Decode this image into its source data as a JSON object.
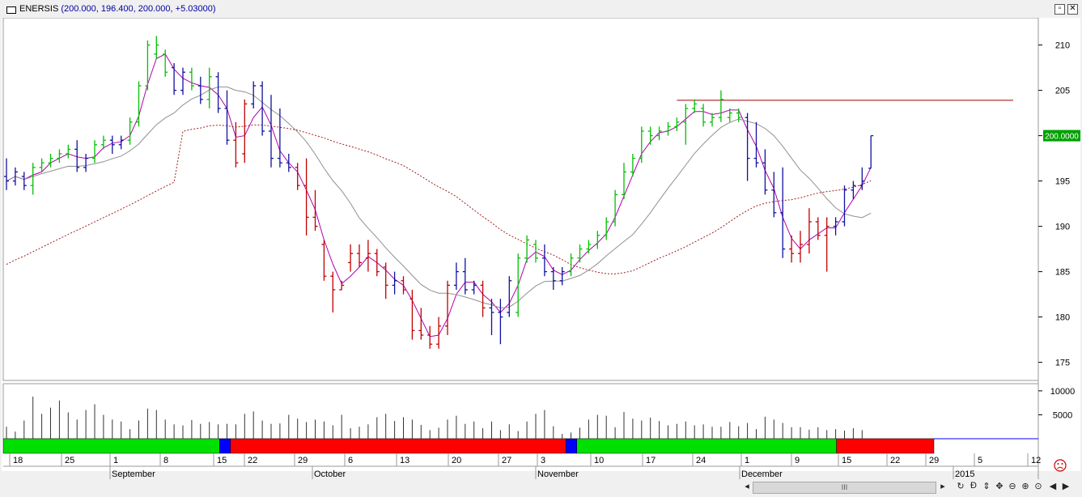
{
  "window": {
    "symbol": "ENERSIS",
    "quote": "(200.000, 196.400, 200.000, +5.03000)",
    "buttons": [
      "restore",
      "close"
    ]
  },
  "price_axis": {
    "ticks": [
      "210",
      "205",
      "200",
      "195",
      "190",
      "185",
      "180",
      "175"
    ],
    "last_price": "200.0000",
    "last_price_color": "#00a000"
  },
  "volume_axis": {
    "ticks": [
      "10000",
      "5000"
    ]
  },
  "date_axis": {
    "days": [
      "18",
      "25",
      "1",
      "8",
      "15",
      "22",
      "29",
      "6",
      "13",
      "20",
      "27",
      "3",
      "10",
      "17",
      "24",
      "1",
      "9",
      "15",
      "22",
      "29",
      "5",
      "12"
    ],
    "months": [
      "September",
      "October",
      "November",
      "December",
      "2015"
    ]
  },
  "status_icon": "sad-face-icon",
  "scroll": {
    "grip": "III",
    "buttons": [
      "C",
      "D",
      "move",
      "zoom-out",
      "zoom-in",
      "prev",
      "next"
    ]
  },
  "colors": {
    "up_bar": "#00c000",
    "down_bar": "#c00000",
    "neutral_bar": "#1010a0",
    "fast_ma": "#b000b0",
    "slow_ma": "#909090",
    "long_ma": "#a02020",
    "resistance": "#a00000",
    "trend_green": "#00e000",
    "trend_red": "#ff0000",
    "trend_blue": "#0000ff"
  },
  "chart_data": {
    "type": "ohlc",
    "xlabel": "",
    "ylabel": "",
    "ylim": [
      173,
      213
    ],
    "ohlc": [
      {
        "d": "Aug 15",
        "o": 195.5,
        "h": 197.5,
        "l": 194.0,
        "c": 195.0,
        "color": "blue"
      },
      {
        "d": "Aug 18",
        "o": 195.0,
        "h": 196.5,
        "l": 194.5,
        "c": 196.0,
        "color": "blue"
      },
      {
        "d": "Aug 19",
        "o": 195.5,
        "h": 196.0,
        "l": 194.0,
        "c": 194.5,
        "color": "blue"
      },
      {
        "d": "Aug 20",
        "o": 194.5,
        "h": 197.0,
        "l": 193.5,
        "c": 196.5,
        "color": "green"
      },
      {
        "d": "Aug 21",
        "o": 196.5,
        "h": 197.5,
        "l": 196.0,
        "c": 197.0,
        "color": "green"
      },
      {
        "d": "Aug 22",
        "o": 197.0,
        "h": 198.0,
        "l": 196.5,
        "c": 197.5,
        "color": "green"
      },
      {
        "d": "Aug 25",
        "o": 197.5,
        "h": 198.5,
        "l": 197.0,
        "c": 198.0,
        "color": "green"
      },
      {
        "d": "Aug 26",
        "o": 198.0,
        "h": 199.0,
        "l": 197.5,
        "c": 198.5,
        "color": "green"
      },
      {
        "d": "Aug 27",
        "o": 198.5,
        "h": 199.5,
        "l": 196.0,
        "c": 196.5,
        "color": "blue"
      },
      {
        "d": "Aug 28",
        "o": 196.5,
        "h": 198.0,
        "l": 196.0,
        "c": 197.5,
        "color": "blue"
      },
      {
        "d": "Aug 29",
        "o": 197.5,
        "h": 199.5,
        "l": 197.0,
        "c": 199.0,
        "color": "green"
      },
      {
        "d": "Sep 1",
        "o": 199.0,
        "h": 200.0,
        "l": 198.5,
        "c": 199.5,
        "color": "green"
      },
      {
        "d": "Sep 2",
        "o": 199.5,
        "h": 200.0,
        "l": 198.0,
        "c": 199.0,
        "color": "blue"
      },
      {
        "d": "Sep 3",
        "o": 199.0,
        "h": 200.0,
        "l": 198.5,
        "c": 199.5,
        "color": "blue"
      },
      {
        "d": "Sep 4",
        "o": 199.5,
        "h": 202.0,
        "l": 199.0,
        "c": 201.5,
        "color": "green"
      },
      {
        "d": "Sep 5",
        "o": 201.5,
        "h": 206.0,
        "l": 201.0,
        "c": 205.5,
        "color": "green"
      },
      {
        "d": "Sep 8",
        "o": 205.5,
        "h": 210.5,
        "l": 205.0,
        "c": 210.0,
        "color": "green"
      },
      {
        "d": "Sep 9",
        "o": 209.0,
        "h": 211.0,
        "l": 208.5,
        "c": 210.0,
        "color": "green"
      },
      {
        "d": "Sep 10",
        "o": 209.0,
        "h": 209.5,
        "l": 206.5,
        "c": 207.0,
        "color": "green"
      },
      {
        "d": "Sep 11",
        "o": 207.5,
        "h": 208.0,
        "l": 204.5,
        "c": 205.0,
        "color": "blue"
      },
      {
        "d": "Sep 12",
        "o": 205.0,
        "h": 207.5,
        "l": 204.5,
        "c": 207.0,
        "color": "blue"
      },
      {
        "d": "Sep 15",
        "o": 207.0,
        "h": 207.5,
        "l": 205.0,
        "c": 205.5,
        "color": "green"
      },
      {
        "d": "Sep 16",
        "o": 205.5,
        "h": 206.5,
        "l": 203.5,
        "c": 204.0,
        "color": "blue"
      },
      {
        "d": "Sep 17",
        "o": 204.0,
        "h": 207.5,
        "l": 203.0,
        "c": 206.5,
        "color": "green"
      },
      {
        "d": "Sep 18",
        "o": 206.5,
        "h": 207.0,
        "l": 202.5,
        "c": 203.0,
        "color": "blue"
      },
      {
        "d": "Sep 19",
        "o": 203.0,
        "h": 205.0,
        "l": 199.0,
        "c": 199.5,
        "color": "blue"
      },
      {
        "d": "Sep 22",
        "o": 199.5,
        "h": 201.5,
        "l": 196.5,
        "c": 197.0,
        "color": "red"
      },
      {
        "d": "Sep 23",
        "o": 198.0,
        "h": 204.0,
        "l": 197.0,
        "c": 203.5,
        "color": "red"
      },
      {
        "d": "Sep 24",
        "o": 203.5,
        "h": 206.0,
        "l": 203.0,
        "c": 205.5,
        "color": "blue"
      },
      {
        "d": "Sep 25",
        "o": 205.5,
        "h": 206.0,
        "l": 200.0,
        "c": 200.5,
        "color": "blue"
      },
      {
        "d": "Sep 26",
        "o": 200.5,
        "h": 204.5,
        "l": 196.5,
        "c": 197.5,
        "color": "blue"
      },
      {
        "d": "Sep 29",
        "o": 197.5,
        "h": 203.0,
        "l": 196.5,
        "c": 197.0,
        "color": "blue"
      },
      {
        "d": "Sep 30",
        "o": 197.0,
        "h": 198.0,
        "l": 196.0,
        "c": 196.5,
        "color": "blue"
      },
      {
        "d": "Oct 1",
        "o": 196.5,
        "h": 197.0,
        "l": 194.0,
        "c": 194.5,
        "color": "red"
      },
      {
        "d": "Oct 2",
        "o": 194.5,
        "h": 197.5,
        "l": 189.0,
        "c": 191.0,
        "color": "red"
      },
      {
        "d": "Oct 3",
        "o": 191.0,
        "h": 194.0,
        "l": 189.5,
        "c": 190.0,
        "color": "red"
      },
      {
        "d": "Oct 6",
        "o": 188.0,
        "h": 188.5,
        "l": 184.0,
        "c": 184.5,
        "color": "red"
      },
      {
        "d": "Oct 7",
        "o": 184.5,
        "h": 185.0,
        "l": 180.5,
        "c": 183.0,
        "color": "red"
      },
      {
        "d": "Oct 8",
        "o": 183.0,
        "h": 184.0,
        "l": 183.0,
        "c": 183.5,
        "color": "red"
      },
      {
        "d": "Oct 9",
        "o": 186.0,
        "h": 188.0,
        "l": 185.0,
        "c": 187.0,
        "color": "red"
      },
      {
        "d": "Oct 10",
        "o": 187.0,
        "h": 188.0,
        "l": 185.5,
        "c": 186.0,
        "color": "red"
      },
      {
        "d": "Oct 13",
        "o": 186.5,
        "h": 188.5,
        "l": 185.0,
        "c": 187.0,
        "color": "red"
      },
      {
        "d": "Oct 14",
        "o": 187.0,
        "h": 187.5,
        "l": 184.5,
        "c": 185.0,
        "color": "red"
      },
      {
        "d": "Oct 15",
        "o": 185.5,
        "h": 186.0,
        "l": 182.0,
        "c": 183.5,
        "color": "red"
      },
      {
        "d": "Oct 16",
        "o": 183.5,
        "h": 185.0,
        "l": 182.5,
        "c": 184.0,
        "color": "blue"
      },
      {
        "d": "Oct 17",
        "o": 184.0,
        "h": 184.5,
        "l": 182.5,
        "c": 183.0,
        "color": "red"
      },
      {
        "d": "Oct 20",
        "o": 182.0,
        "h": 183.0,
        "l": 177.5,
        "c": 178.5,
        "color": "red"
      },
      {
        "d": "Oct 21",
        "o": 178.5,
        "h": 181.0,
        "l": 177.5,
        "c": 178.0,
        "color": "red"
      },
      {
        "d": "Oct 22",
        "o": 178.0,
        "h": 179.0,
        "l": 176.5,
        "c": 177.0,
        "color": "red"
      },
      {
        "d": "Oct 23",
        "o": 177.0,
        "h": 180.0,
        "l": 176.5,
        "c": 179.0,
        "color": "red"
      },
      {
        "d": "Oct 24",
        "o": 179.0,
        "h": 184.0,
        "l": 178.0,
        "c": 183.5,
        "color": "red"
      },
      {
        "d": "Oct 27",
        "o": 183.5,
        "h": 186.0,
        "l": 183.0,
        "c": 185.0,
        "color": "blue"
      },
      {
        "d": "Oct 28",
        "o": 185.0,
        "h": 186.5,
        "l": 182.5,
        "c": 183.0,
        "color": "blue"
      },
      {
        "d": "Oct 29",
        "o": 183.0,
        "h": 184.0,
        "l": 182.5,
        "c": 183.5,
        "color": "blue"
      },
      {
        "d": "Oct 30",
        "o": 183.5,
        "h": 184.0,
        "l": 180.0,
        "c": 181.0,
        "color": "red"
      },
      {
        "d": "Oct 31",
        "o": 181.0,
        "h": 182.0,
        "l": 178.0,
        "c": 180.5,
        "color": "blue"
      },
      {
        "d": "Nov 3",
        "o": 180.5,
        "h": 182.0,
        "l": 177.0,
        "c": 180.0,
        "color": "blue"
      },
      {
        "d": "Nov 4",
        "o": 180.5,
        "h": 184.5,
        "l": 180.0,
        "c": 184.0,
        "color": "blue"
      },
      {
        "d": "Nov 5",
        "o": 180.5,
        "h": 187.0,
        "l": 180.0,
        "c": 186.5,
        "color": "green"
      },
      {
        "d": "Nov 6",
        "o": 186.5,
        "h": 189.0,
        "l": 186.0,
        "c": 188.5,
        "color": "green"
      },
      {
        "d": "Nov 7",
        "o": 188.0,
        "h": 188.5,
        "l": 186.0,
        "c": 186.5,
        "color": "green"
      },
      {
        "d": "Nov 10",
        "o": 186.5,
        "h": 188.0,
        "l": 184.5,
        "c": 185.0,
        "color": "blue"
      },
      {
        "d": "Nov 11",
        "o": 185.0,
        "h": 185.5,
        "l": 183.0,
        "c": 184.0,
        "color": "blue"
      },
      {
        "d": "Nov 12",
        "o": 184.0,
        "h": 185.5,
        "l": 183.5,
        "c": 185.0,
        "color": "blue"
      },
      {
        "d": "Nov 13",
        "o": 185.0,
        "h": 187.0,
        "l": 184.5,
        "c": 186.5,
        "color": "green"
      },
      {
        "d": "Nov 14",
        "o": 186.5,
        "h": 188.0,
        "l": 186.0,
        "c": 187.5,
        "color": "green"
      },
      {
        "d": "Nov 17",
        "o": 187.5,
        "h": 188.5,
        "l": 187.0,
        "c": 188.0,
        "color": "green"
      },
      {
        "d": "Nov 18",
        "o": 188.0,
        "h": 189.5,
        "l": 187.5,
        "c": 189.0,
        "color": "green"
      },
      {
        "d": "Nov 19",
        "o": 189.0,
        "h": 191.0,
        "l": 188.5,
        "c": 190.5,
        "color": "green"
      },
      {
        "d": "Nov 20",
        "o": 190.5,
        "h": 194.0,
        "l": 190.0,
        "c": 193.5,
        "color": "green"
      },
      {
        "d": "Nov 21",
        "o": 193.5,
        "h": 197.0,
        "l": 193.0,
        "c": 196.0,
        "color": "green"
      },
      {
        "d": "Nov 24",
        "o": 196.0,
        "h": 198.0,
        "l": 195.5,
        "c": 197.5,
        "color": "green"
      },
      {
        "d": "Nov 25",
        "o": 197.5,
        "h": 201.0,
        "l": 197.0,
        "c": 200.5,
        "color": "green"
      },
      {
        "d": "Nov 26",
        "o": 200.5,
        "h": 201.0,
        "l": 199.0,
        "c": 200.0,
        "color": "green"
      },
      {
        "d": "Nov 27",
        "o": 200.0,
        "h": 201.0,
        "l": 199.5,
        "c": 200.5,
        "color": "green"
      },
      {
        "d": "Nov 28",
        "o": 200.5,
        "h": 201.5,
        "l": 200.0,
        "c": 201.0,
        "color": "green"
      },
      {
        "d": "Dec 1",
        "o": 201.0,
        "h": 202.0,
        "l": 200.5,
        "c": 201.5,
        "color": "green"
      },
      {
        "d": "Dec 2",
        "o": 201.5,
        "h": 203.5,
        "l": 199.0,
        "c": 203.0,
        "color": "green"
      },
      {
        "d": "Dec 3",
        "o": 203.0,
        "h": 204.0,
        "l": 202.5,
        "c": 203.5,
        "color": "green"
      },
      {
        "d": "Dec 4",
        "o": 203.0,
        "h": 203.5,
        "l": 201.0,
        "c": 201.5,
        "color": "green"
      },
      {
        "d": "Dec 5",
        "o": 201.5,
        "h": 202.5,
        "l": 201.0,
        "c": 202.0,
        "color": "green"
      },
      {
        "d": "Dec 8",
        "o": 202.0,
        "h": 205.0,
        "l": 201.5,
        "c": 204.0,
        "color": "green"
      },
      {
        "d": "Dec 9",
        "o": 202.0,
        "h": 203.0,
        "l": 201.5,
        "c": 202.5,
        "color": "green"
      },
      {
        "d": "Dec 10",
        "o": 202.5,
        "h": 203.0,
        "l": 201.5,
        "c": 202.0,
        "color": "green"
      },
      {
        "d": "Dec 11",
        "o": 202.0,
        "h": 202.5,
        "l": 195.0,
        "c": 197.5,
        "color": "blue"
      },
      {
        "d": "Dec 12",
        "o": 197.5,
        "h": 201.5,
        "l": 196.5,
        "c": 197.0,
        "color": "blue"
      },
      {
        "d": "Dec 15",
        "o": 197.0,
        "h": 198.5,
        "l": 193.5,
        "c": 194.0,
        "color": "blue"
      },
      {
        "d": "Dec 16",
        "o": 194.0,
        "h": 196.0,
        "l": 191.0,
        "c": 191.5,
        "color": "blue"
      },
      {
        "d": "Dec 17",
        "o": 191.5,
        "h": 196.5,
        "l": 186.5,
        "c": 187.5,
        "color": "blue"
      },
      {
        "d": "Dec 18",
        "o": 187.5,
        "h": 189.0,
        "l": 186.0,
        "c": 187.0,
        "color": "red"
      },
      {
        "d": "Dec 19",
        "o": 187.0,
        "h": 189.5,
        "l": 186.0,
        "c": 188.0,
        "color": "red"
      },
      {
        "d": "Dec 22",
        "o": 188.0,
        "h": 192.0,
        "l": 187.0,
        "c": 190.5,
        "color": "red"
      },
      {
        "d": "Dec 23",
        "o": 190.5,
        "h": 191.0,
        "l": 188.5,
        "c": 189.0,
        "color": "red"
      },
      {
        "d": "Dec 24",
        "o": 189.0,
        "h": 191.0,
        "l": 185.0,
        "c": 190.0,
        "color": "red"
      },
      {
        "d": "Dec 26",
        "o": 190.0,
        "h": 191.0,
        "l": 189.0,
        "c": 190.5,
        "color": "blue"
      },
      {
        "d": "Dec 29",
        "o": 190.5,
        "h": 194.5,
        "l": 190.0,
        "c": 194.0,
        "color": "blue"
      },
      {
        "d": "Dec 30",
        "o": 194.0,
        "h": 195.0,
        "l": 193.0,
        "c": 194.5,
        "color": "blue"
      },
      {
        "d": "Dec 31",
        "o": 194.5,
        "h": 196.5,
        "l": 194.0,
        "c": 195.0,
        "color": "blue"
      },
      {
        "d": "Jan 2",
        "o": 196.4,
        "h": 200.0,
        "l": 196.4,
        "c": 200.0,
        "color": "blue"
      }
    ],
    "volume": [
      2500,
      1500,
      3800,
      8800,
      5200,
      6500,
      8000,
      5500,
      4000,
      6000,
      7200,
      5000,
      4000,
      3600,
      2000,
      3800,
      6300,
      6000,
      4000,
      3000,
      2800,
      3900,
      3100,
      3500,
      3000,
      3100,
      3000,
      5200,
      5700,
      3800,
      3100,
      3200,
      5000,
      4200,
      3500,
      4000,
      3600,
      2800,
      5000,
      2200,
      2500,
      3000,
      4500,
      5200,
      3700,
      4500,
      4000,
      2900,
      1800,
      2300,
      4000,
      4800,
      3100,
      3600,
      2200,
      3600,
      1800,
      3000,
      1600,
      3600,
      5200,
      6000,
      2600,
      1000,
      1300,
      2300,
      4000,
      5000,
      4800,
      2400,
      5600,
      4200,
      3800,
      4400,
      3700,
      2800,
      3100,
      3600,
      2800,
      3000,
      2500,
      2500,
      3500,
      2600,
      3300,
      2000,
      4600,
      4000,
      3300,
      2400,
      2400,
      1900,
      2400,
      1800,
      2000,
      1700,
      2200,
      1800
    ],
    "volume_ylim": [
      0,
      11500
    ],
    "trend_bands": [
      {
        "color": "green",
        "from": 0,
        "to": 40
      },
      {
        "color": "blue",
        "from": 40,
        "to": 42
      },
      {
        "color": "red",
        "from": 42,
        "to": 104
      },
      {
        "color": "blue",
        "from": 104,
        "to": 106
      },
      {
        "color": "green",
        "from": 106,
        "to": 154
      },
      {
        "color": "red",
        "from": 154,
        "to": 172
      }
    ],
    "resistance_level": 203.9,
    "moving_averages": [
      "fast",
      "slow",
      "long"
    ],
    "grid": false,
    "legend": "none"
  }
}
